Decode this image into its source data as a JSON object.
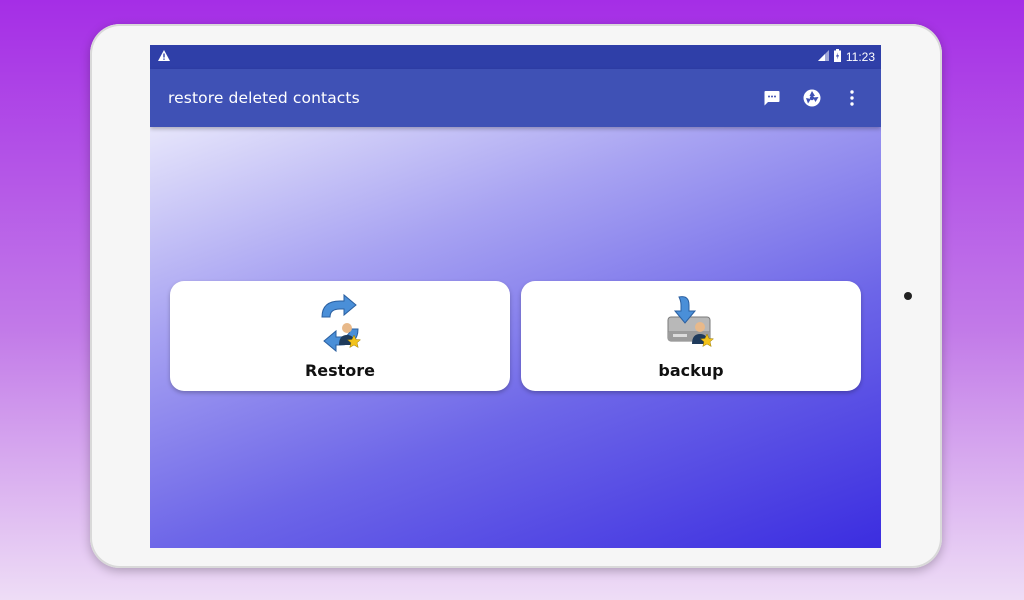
{
  "status_bar": {
    "warning_icon": "warning-icon",
    "signal_icon": "signal-icon",
    "battery_icon": "battery-icon",
    "time": "11:23"
  },
  "app_bar": {
    "title": "restore deleted contacts",
    "actions": [
      "message-icon",
      "shutter-icon",
      "overflow-menu-icon"
    ]
  },
  "cards": [
    {
      "label": "Restore",
      "icon": "restore-contacts-icon"
    },
    {
      "label": "backup",
      "icon": "backup-contacts-icon"
    }
  ],
  "colors": {
    "status_bar": "#2f3fa8",
    "app_bar": "#3f51b5",
    "background_gradient_start": "#e7e6fb",
    "background_gradient_end": "#3b2de0"
  }
}
